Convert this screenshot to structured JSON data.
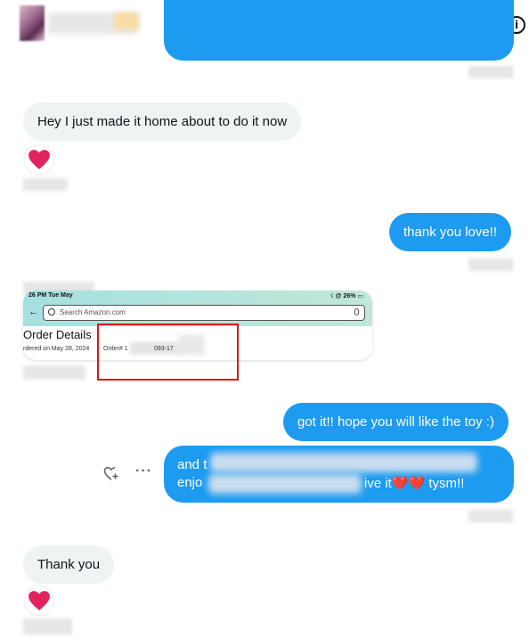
{
  "conversation": {
    "info_icon": "info-icon",
    "messages": {
      "incoming_1": "Hey I just made it home about to do it now",
      "outgoing_1": "thank you love!!",
      "screenshot": {
        "status_left": "26 PM   Tue May",
        "status_right": "☇ @ 26% ▭",
        "search_placeholder": "Search Amazon.com",
        "title": "Order Details",
        "ordered_on": "rdered on May 28, 2024",
        "order_prefix": "Order# 1",
        "order_suffix": "093-17"
      },
      "outgoing_2": "got it!! hope you will like the toy :)",
      "outgoing_3_line1": "and t",
      "outgoing_3_line2": "enjo",
      "outgoing_3_end": "ive it❤️❤️ tysm!!",
      "incoming_2": "Thank you"
    },
    "reaction": "❤️",
    "colors": {
      "outgoing": "#1d9bf0",
      "incoming": "#eff3f4",
      "heart": "#e0245e",
      "highlight": "#e0161b"
    }
  }
}
